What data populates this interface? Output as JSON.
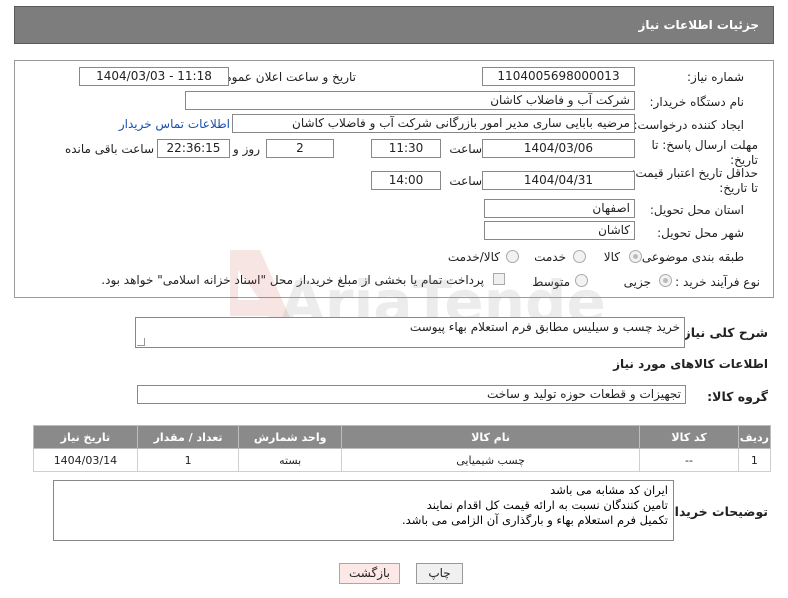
{
  "header": {
    "title": "جزئیات اطلاعات نیاز"
  },
  "form": {
    "need_number_label": "شماره نیاز:",
    "need_number": "1104005698000013",
    "announce_label": "تاریخ و ساعت اعلان عمومی:",
    "announce_value": "1404/03/03 - 11:18",
    "buyer_org_label": "نام دستگاه خریدار:",
    "buyer_org": "شرکت آب و فاضلاب کاشان",
    "creator_label": "ایجاد کننده درخواست:",
    "creator": "مرضیه بابایی ساری مدیر امور بازرگانی شرکت آب و فاضلاب کاشان",
    "contact_link": "اطلاعات تماس خریدار",
    "deadline_label": "مهلت ارسال پاسخ: تا تاریخ:",
    "deadline_date": "1404/03/06",
    "time_label": "ساعت",
    "deadline_time": "11:30",
    "days_value": "2",
    "days_label": "روز و",
    "remaining_time": "22:36:15",
    "remaining_label": "ساعت باقی مانده",
    "validity_label": "حداقل تاریخ اعتبار قیمت: تا تاریخ:",
    "validity_date": "1404/04/31",
    "validity_time": "14:00",
    "province_label": "استان محل تحویل:",
    "province": "اصفهان",
    "city_label": "شهر محل تحویل:",
    "city": "کاشان",
    "category_label": "طبقه بندی موضوعی:",
    "category_options": [
      "کالا",
      "خدمت",
      "کالا/خدمت"
    ],
    "category_selected": "کالا",
    "process_label": "نوع فرآیند خرید :",
    "process_options": [
      "جزیی",
      "متوسط"
    ],
    "process_selected": "جزیی",
    "payment_note": "پرداخت تمام یا بخشی از مبلغ خرید،از محل \"اسناد خزانه اسلامی\" خواهد بود."
  },
  "description": {
    "label": "شرح کلی نیاز:",
    "value": "خرید چسب و سیلیس مطابق فرم استعلام بهاء پیوست"
  },
  "goods_section": {
    "title": "اطلاعات کالاهای مورد نیاز"
  },
  "goods_group": {
    "label": "گروه کالا:",
    "value": "تجهیزات و قطعات حوزه تولید و ساخت"
  },
  "table": {
    "headers": [
      "ردیف",
      "کد کالا",
      "نام کالا",
      "واحد شمارش",
      "تعداد / مقدار",
      "تاریخ نیاز"
    ],
    "rows": [
      [
        "1",
        "--",
        "چسب شیمیایی",
        "بسته",
        "1",
        "1404/03/14"
      ]
    ]
  },
  "buyer_notes": {
    "label": "توضیحات خریدار:",
    "value": "ایران کد مشابه می باشد\nتامین کنندگان نسبت به ارائه قیمت کل اقدام نمایند\nتکمیل فرم استعلام بهاء و بارگذاری آن الزامی می باشد."
  },
  "buttons": {
    "print": "چاپ",
    "back": "بازگشت"
  },
  "watermark": {
    "text": "AriaTender.net"
  },
  "colors": {
    "header_bg": "#7d7d7d",
    "table_header_bg": "#8a8a8a",
    "link": "#1a4fb0",
    "back_button_bg": "#fde8e8"
  }
}
